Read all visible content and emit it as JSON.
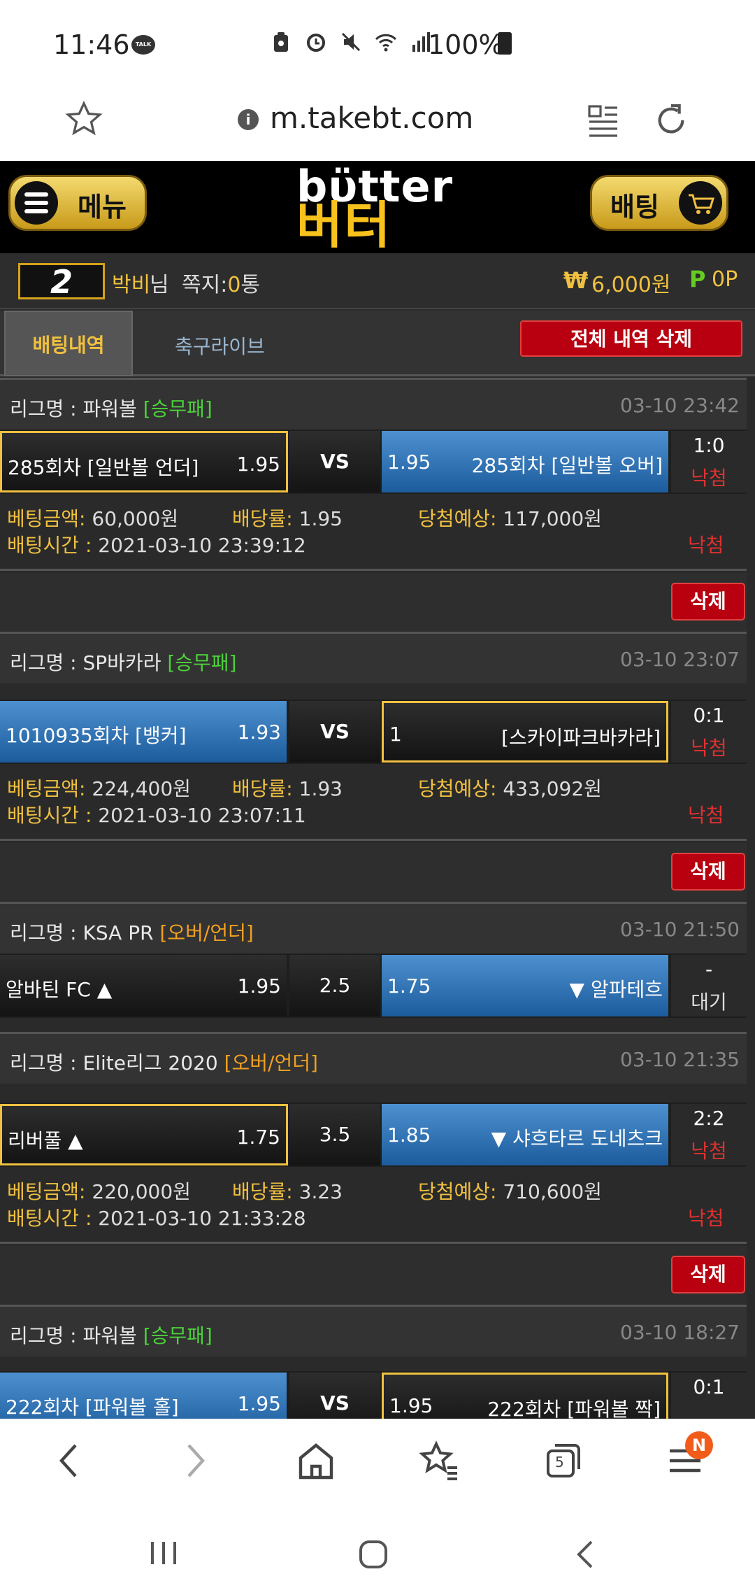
{
  "status": {
    "time": "11:46",
    "talk": "TALK",
    "battery": "100%"
  },
  "browser": {
    "url": "m.takebt.com",
    "tabs_count": "5",
    "badge": "N"
  },
  "header": {
    "logo_en": "bϋtter",
    "logo_kr": "버터",
    "menu_label": "메뉴",
    "bet_label": "배팅"
  },
  "user": {
    "level": "2",
    "name": "박비",
    "suffix": "님",
    "msg_label": "쪽지:",
    "msg_count": "0",
    "msg_unit": "통",
    "currency_symbol": "₩",
    "money": "6,000원",
    "point_symbol": "P",
    "points": "0P"
  },
  "tabs": {
    "history": "배팅내역",
    "soccer_live": "축구라이브",
    "delete_all": "전체 내역 삭제"
  },
  "labels": {
    "league": "리그명 : ",
    "vs": "VS",
    "bet_amount": "베팅금액:",
    "odds": "배당률:",
    "expected": "당첨예상:",
    "bet_time": "배팅시간 : ",
    "delete": "삭제"
  },
  "bets": [
    {
      "league": "파워볼",
      "type": "[승무패]",
      "time": "03-10 23:42",
      "home": "285회차 [일반볼 언더]",
      "home_odds": "1.95",
      "mid": "VS",
      "away_odds": "1.95",
      "away": "285회차 [일반볼 오버]",
      "score": "1:0",
      "result": "낙첨",
      "amount": "60,000원",
      "rate": "1.95",
      "expected": "117,000원",
      "bet_time": "2021-03-10 23:39:12",
      "result2": "낙첨"
    },
    {
      "league": "SP바카라",
      "type": "[승무패]",
      "time": "03-10 23:07",
      "home": "1010935회차 [뱅커]",
      "home_odds": "1.93",
      "mid": "VS",
      "away_odds": "1",
      "away": "[스카이파크바카라]",
      "score": "0:1",
      "result": "낙첨",
      "amount": "224,400원",
      "rate": "1.93",
      "expected": "433,092원",
      "bet_time": "2021-03-10 23:07:11",
      "result2": "낙첨"
    },
    {
      "league": "KSA PR",
      "type": "[오버/언더]",
      "time": "03-10 21:50",
      "home": "알바틴 FC ▲",
      "home_odds": "1.95",
      "mid": "2.5",
      "away_odds": "1.75",
      "away": "▼ 알파테흐",
      "score": "-",
      "result": "대기"
    },
    {
      "league": "Elite리그 2020",
      "type": "[오버/언더]",
      "time": "03-10 21:35",
      "home": "리버풀 ▲",
      "home_odds": "1.75",
      "mid": "3.5",
      "away_odds": "1.85",
      "away": "▼ 샤흐타르 도네츠크",
      "score": "2:2",
      "result": "낙첨",
      "amount": "220,000원",
      "rate": "3.23",
      "expected": "710,600원",
      "bet_time": "2021-03-10 21:33:28",
      "result2": "낙첨"
    },
    {
      "league": "파워볼",
      "type": "[승무패]",
      "time": "03-10 18:27",
      "home": "222회차 [파워볼 홀]",
      "home_odds": "1.95",
      "mid": "VS",
      "away_odds": "1.95",
      "away": "222회차 [파워볼 짝]",
      "score": "0:1"
    }
  ]
}
